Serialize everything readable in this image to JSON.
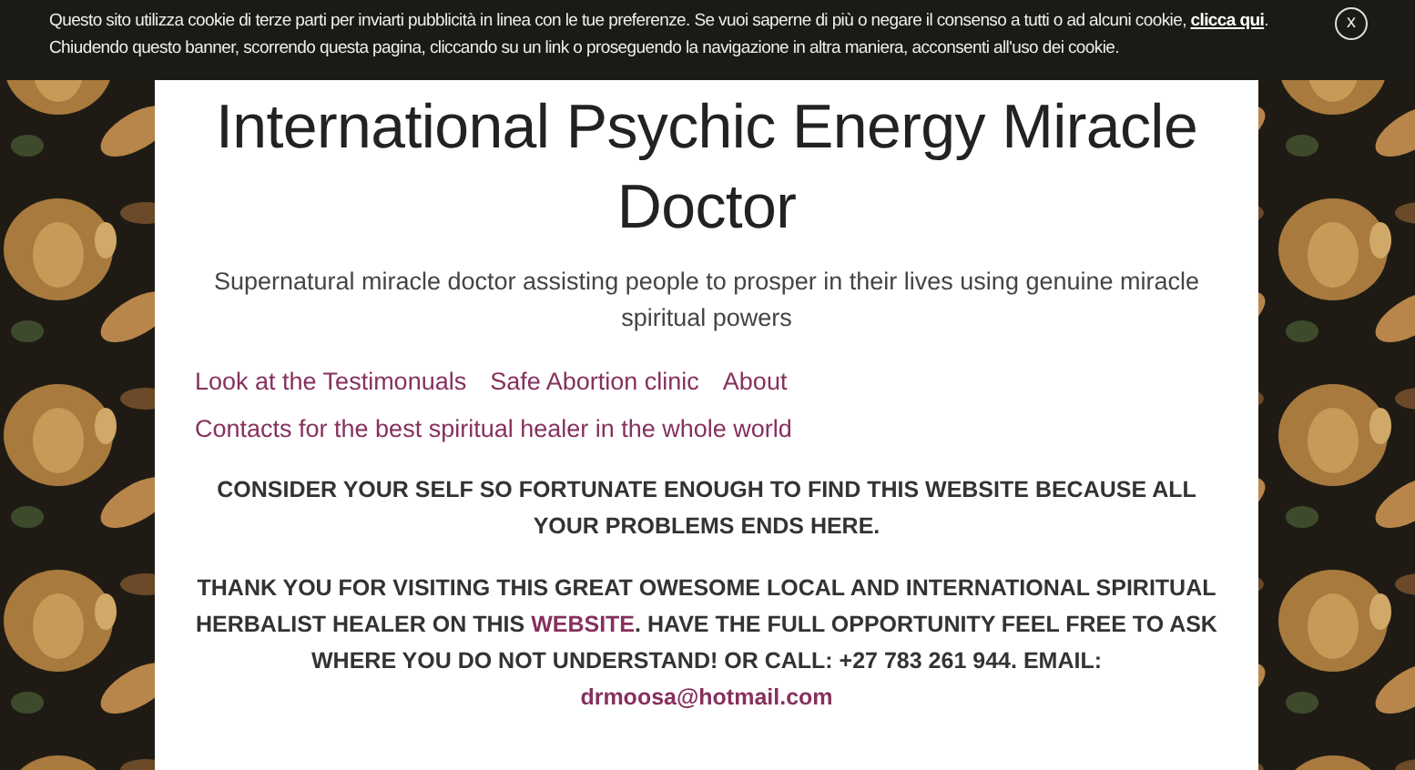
{
  "cookie_banner": {
    "text": "Questo sito utilizza cookie di terze parti per inviarti pubblicità in linea con le tue preferenze. Se vuoi saperne di più o negare il consenso a tutti o ad alcuni cookie,",
    "link": "clicca qui",
    "text_after": ". Chiudendo questo banner, scorrendo questa pagina, cliccando su un link o proseguendo la navigazione in altra maniera, acconsenti all'uso dei cookie.",
    "close": "x"
  },
  "site": {
    "title": "International Psychic Energy Miracle Doctor",
    "tagline": "Supernatural miracle doctor assisting people to prosper in their lives using genuine miracle spiritual powers"
  },
  "nav": [
    {
      "label": "Look at the Testimonuals"
    },
    {
      "label": "Safe Abortion clinic"
    },
    {
      "label": "About"
    },
    {
      "label": "Contacts for the best spiritual healer in the whole world"
    }
  ],
  "content": [
    {
      "kind": "heading",
      "text": "CONSIDER YOUR SELF SO FORTUNATE ENOUGH TO FIND THIS WEBSITE BECAUSE ALL YOUR PROBLEMS ENDS HERE."
    },
    {
      "kind": "contact",
      "before": "THANK YOU FOR VISITING THIS GREAT OWESOME LOCAL AND INTERNATIONAL SPIRITUAL HERBALIST HEALER ON THIS",
      "link": "WEBSITE",
      "middle": ".  HAVE THE FULL OPPORTUNITY  FEEL FREE TO ASK WHERE YOU DO NOT UNDERSTAND! OR  CALL: +27 783 261 944. EMAIL: ",
      "email": "drmoosa@hotmail.com"
    }
  ]
}
